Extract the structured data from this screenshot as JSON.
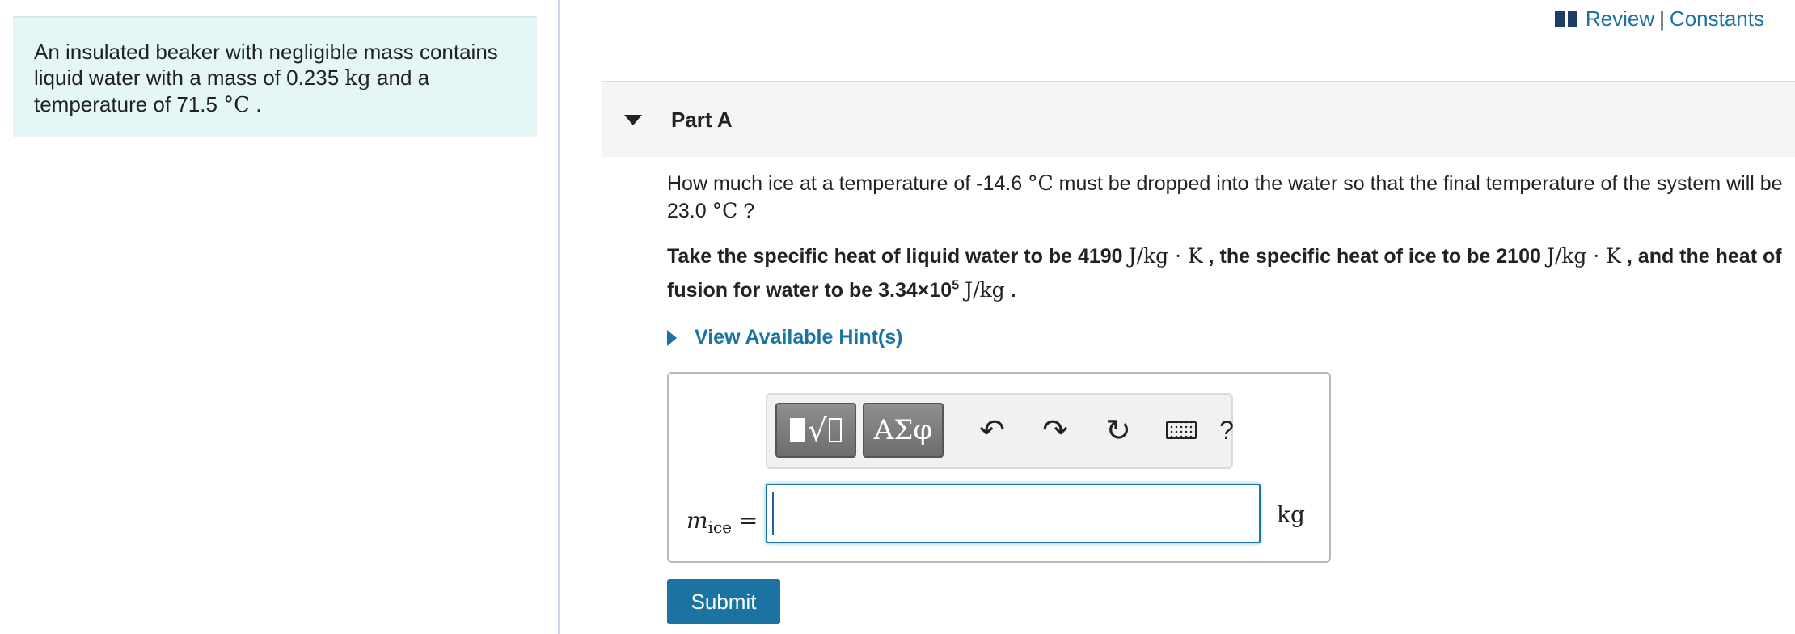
{
  "intro": {
    "line1": "An insulated beaker with negligible mass contains",
    "line2a": "liquid water with a mass of 0.235 ",
    "mass_unit": "kg",
    "line2b": " and a",
    "line3a": "temperature of 71.5 ",
    "temp_unit": "°C",
    "line3b": " ."
  },
  "header_links": {
    "review": "Review",
    "separator": "|",
    "constants": "Constants"
  },
  "part": {
    "title": "Part A"
  },
  "question": {
    "t1": "How much ice at a temperature of -14.6 ",
    "u1": "°C",
    "t2": " must be dropped into the water so that the final temperature of the system will be 23.0 ",
    "u2": "°C",
    "t3": " ?"
  },
  "given": {
    "b1": "Take the specific heat of liquid water to be 4190 ",
    "u1": "J/kg · K",
    "b2": " , the specific heat of ice to be 2100 ",
    "u2": "J/kg · K",
    "b3": " , and the heat of fusion for water to be 3.34×10",
    "exp": "5",
    "b4": " ",
    "u3": "J/kg",
    "b5": " ."
  },
  "hint": {
    "label": "View Available Hint(s)"
  },
  "toolbar": {
    "greek_label": "ΑΣφ",
    "undo_glyph": "↶",
    "redo_glyph": "↷",
    "reset_glyph": "↻",
    "help_label": "?"
  },
  "answer": {
    "var": "m",
    "sub": "ice",
    "equals": " =",
    "value": "",
    "unit": "kg"
  },
  "submit": {
    "label": "Submit"
  }
}
